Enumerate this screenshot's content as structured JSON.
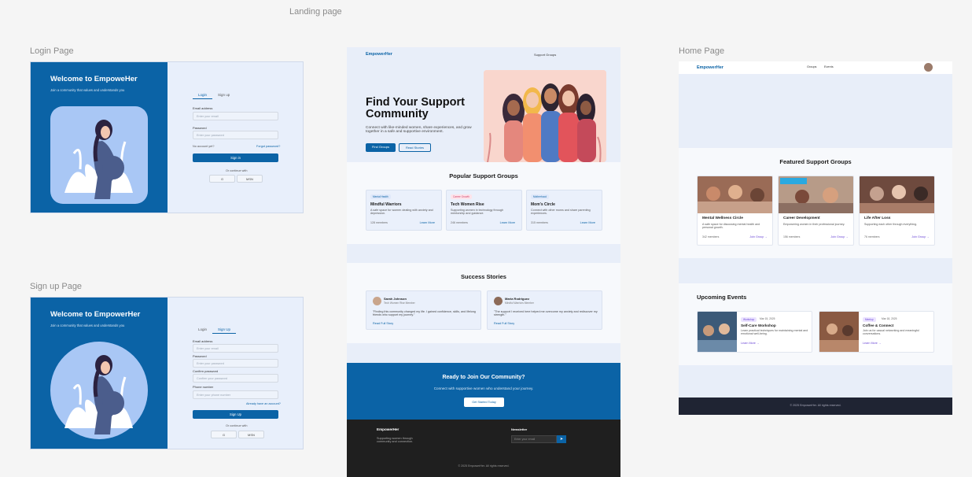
{
  "labels": {
    "landing": "Landing page",
    "login": "Login Page",
    "signup": "Sign up Page",
    "home": "Home Page"
  },
  "login": {
    "welcome": "Welcome to EmpoweHer",
    "tagline": "Join a community that values and understands you",
    "tab_login": "Login",
    "tab_signup": "Sign up",
    "email_label": "Email address",
    "email_placeholder": "Enter your email",
    "password_label": "Password",
    "password_placeholder": "Enter your password",
    "no_account": "No account yet?",
    "forgot": "Forgot password?",
    "signin": "Sign in",
    "or": "Or continue with",
    "google": "G",
    "other": "MSN"
  },
  "signup": {
    "welcome": "Welcome to EmpowerHer",
    "tagline": "Join a community that values and understands you",
    "tab_login": "Login",
    "tab_signup": "Sign Up",
    "email_label": "Email address",
    "email_placeholder": "Enter your email",
    "password_label": "Password",
    "password_placeholder": "Enter your password",
    "confirm_label": "Confirm password",
    "confirm_placeholder": "Confirm your password",
    "phone_label": "Phone number",
    "phone_placeholder": "Enter your phone number",
    "have_account": "Already have an account?",
    "signup_btn": "Sign Up",
    "or": "Or continue with",
    "google": "G",
    "other": "MSN"
  },
  "landing": {
    "brand": "EmpowerHer",
    "nav_link": "Support Groups",
    "hero_title": "Find Your Support Community",
    "hero_text": "Connect with like-minded women, share experiences, and grow together in a safe and supportive environment.",
    "btn_find": "Find Groups",
    "btn_read": "Read Stories",
    "popular_title": "Popular Support Groups",
    "groups": [
      {
        "tag": "Mental Health",
        "title": "Mindful Warriors",
        "desc": "A safe space for women dealing with anxiety and depression.",
        "members": "128 members",
        "link": "Learn More"
      },
      {
        "tag": "Career Growth",
        "title": "Tech Women Rise",
        "desc": "Supporting women in technology through mentorship and guidance.",
        "members": "246 members",
        "link": "Learn More"
      },
      {
        "tag": "Motherhood",
        "title": "Mom's Circle",
        "desc": "Connect with other moms and share parenting experiences.",
        "members": "315 members",
        "link": "Learn More"
      }
    ],
    "stories_title": "Success Stories",
    "stories": [
      {
        "name": "Sarah Johnson",
        "role": "Tech Women Rise Member",
        "quote": "\"Finding this community changed my life. I gained confidence, skills, and lifelong friends who support my journey.\"",
        "link": "Read Full Story"
      },
      {
        "name": "Maria Rodriguez",
        "role": "Mindful Warriors Member",
        "quote": "\"The support I received here helped me overcome my anxiety and rediscover my strength.\"",
        "link": "Read Full Story"
      }
    ],
    "cta_title": "Ready to Join Our Community?",
    "cta_text": "Connect with supportive women who understand your journey.",
    "cta_btn": "Get Started Today",
    "footer_brand": "EmpowerHer",
    "footer_text": "Supporting women through community and connection.",
    "newsletter": "Newsletter",
    "newsletter_placeholder": "Enter your email",
    "copyright": "© 2025 EmpowerHer. All rights reserved."
  },
  "home": {
    "brand": "EmpowerHer",
    "nav_groups": "Groups",
    "nav_events": "Events",
    "featured_title": "Featured Support Groups",
    "cards": [
      {
        "title": "Mental Wellness Circle",
        "desc": "A safe space for discussing mental health and personal growth.",
        "members": "342 members",
        "link": "Join Group →"
      },
      {
        "title": "Career Development",
        "desc": "Empowering women in their professional journey.",
        "members": "156 members",
        "link": "Join Group →"
      },
      {
        "title": "Life After Loss",
        "desc": "Supporting each other through everything.",
        "members": "76 members",
        "link": "Join Group →"
      }
    ],
    "events_title": "Upcoming Events",
    "events": [
      {
        "tag": "Workshop",
        "date": "Mar 15, 2025",
        "title": "Self-Care Workshop",
        "desc": "Learn practical techniques for maintaining mental and emotional well-being.",
        "link": "Learn More →"
      },
      {
        "tag": "Meetup",
        "date": "Mar 18, 2025",
        "title": "Coffee & Connect",
        "desc": "Join us for casual networking and meaningful conversations.",
        "link": "Learn More →"
      }
    ],
    "copyright": "© 2025 EmpowerHer. All rights reserved."
  },
  "colors": {
    "primary": "#0b63a6",
    "accent": "#6b47d6",
    "footer": "#1f1f1f"
  }
}
